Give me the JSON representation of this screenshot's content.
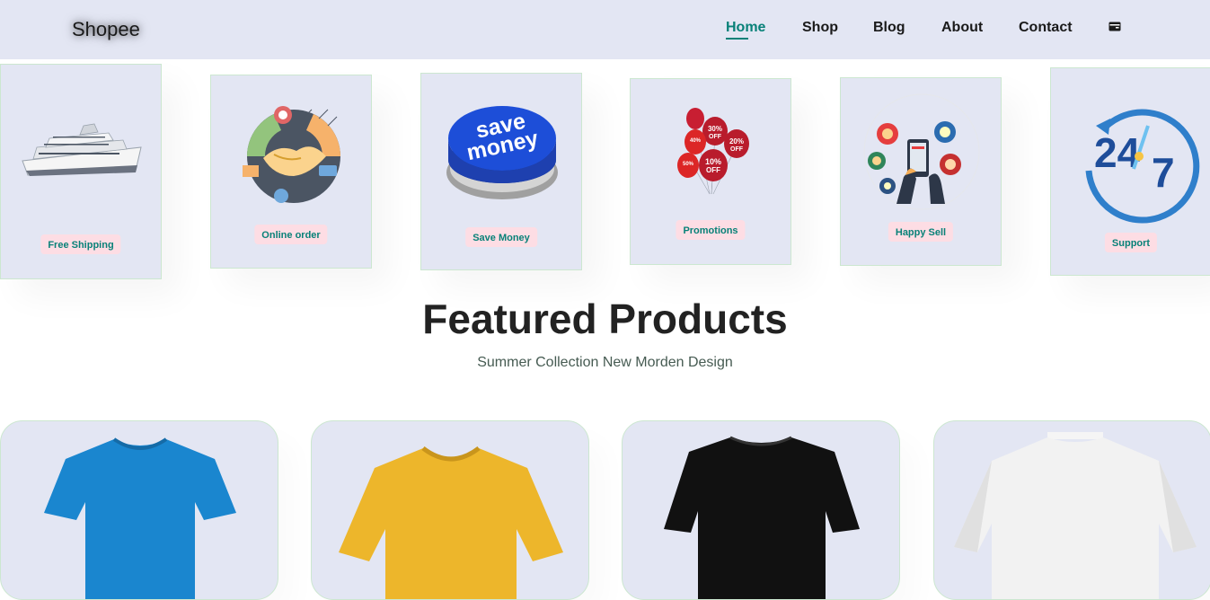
{
  "header": {
    "logo": "Shopee",
    "nav": [
      {
        "label": "Home",
        "active": true
      },
      {
        "label": "Shop"
      },
      {
        "label": "Blog"
      },
      {
        "label": "About"
      },
      {
        "label": "Contact"
      }
    ],
    "bag_icon": "shopping-bag-icon"
  },
  "features": [
    {
      "label": "Free Shipping",
      "icon": "cruise-ship-image"
    },
    {
      "label": "Online order",
      "icon": "handshake-image"
    },
    {
      "label": "Save Money",
      "icon": "save-money-button-image"
    },
    {
      "label": "Promotions",
      "icon": "discount-balloons-image"
    },
    {
      "label": "Happy Sell",
      "icon": "mobile-shopping-image"
    },
    {
      "label": "Support",
      "icon": "24-7-support-image"
    }
  ],
  "featured": {
    "title": "Featured Products",
    "subtitle": "Summer Collection New Morden Design"
  },
  "products": [
    {
      "color": "#1a86cf",
      "icon": "blue-tshirt-image"
    },
    {
      "color": "#edb62b",
      "icon": "yellow-tshirt-image"
    },
    {
      "color": "#111111",
      "icon": "black-tshirt-image"
    },
    {
      "color": "#f2f2f2",
      "icon": "white-tshirt-image"
    }
  ],
  "colors": {
    "accent": "#088178",
    "header_bg": "#e3e6f3",
    "label_bg": "#fddde4"
  }
}
